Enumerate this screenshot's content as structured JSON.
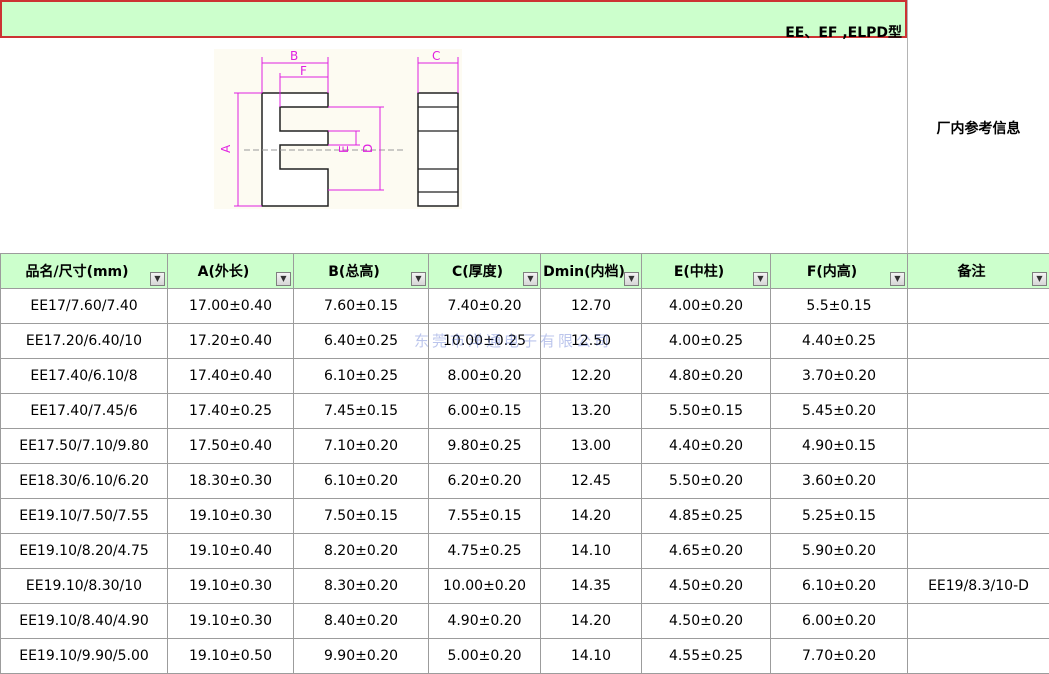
{
  "title": "EE、EF ,ELPD型",
  "side_label": "厂内参考信息",
  "diagram_labels": {
    "a": "A",
    "b": "B",
    "c": "C",
    "d": "D",
    "e": "E",
    "f": "F"
  },
  "columns": [
    "品名/尺寸(mm)",
    "A(外长)",
    "B(总高)",
    "C(厚度)",
    "Dmin(内档)",
    "E(中柱)",
    "F(内高)",
    "备注"
  ],
  "rows": [
    [
      "EE17/7.60/7.40",
      "17.00±0.40",
      "7.60±0.15",
      "7.40±0.20",
      "12.70",
      "4.00±0.20",
      "5.5±0.15",
      ""
    ],
    [
      "EE17.20/6.40/10",
      "17.20±0.40",
      "6.40±0.25",
      "10.00±0.25",
      "12.50",
      "4.00±0.25",
      "4.40±0.25",
      ""
    ],
    [
      "EE17.40/6.10/8",
      "17.40±0.40",
      "6.10±0.25",
      "8.00±0.20",
      "12.20",
      "4.80±0.20",
      "3.70±0.20",
      ""
    ],
    [
      "EE17.40/7.45/6",
      "17.40±0.25",
      "7.45±0.15",
      "6.00±0.15",
      "13.20",
      "5.50±0.15",
      "5.45±0.20",
      ""
    ],
    [
      "EE17.50/7.10/9.80",
      "17.50±0.40",
      "7.10±0.20",
      "9.80±0.25",
      "13.00",
      "4.40±0.20",
      "4.90±0.15",
      ""
    ],
    [
      "EE18.30/6.10/6.20",
      "18.30±0.30",
      "6.10±0.20",
      "6.20±0.20",
      "12.45",
      "5.50±0.20",
      "3.60±0.20",
      ""
    ],
    [
      "EE19.10/7.50/7.55",
      "19.10±0.30",
      "7.50±0.15",
      "7.55±0.15",
      "14.20",
      "4.85±0.25",
      "5.25±0.15",
      ""
    ],
    [
      "EE19.10/8.20/4.75",
      "19.10±0.40",
      "8.20±0.20",
      "4.75±0.25",
      "14.10",
      "4.65±0.20",
      "5.90±0.20",
      ""
    ],
    [
      "EE19.10/8.30/10",
      "19.10±0.30",
      "8.30±0.20",
      "10.00±0.20",
      "14.35",
      "4.50±0.20",
      "6.10±0.20",
      "EE19/8.3/10-D"
    ],
    [
      "EE19.10/8.40/4.90",
      "19.10±0.30",
      "8.40±0.20",
      "4.90±0.20",
      "14.20",
      "4.50±0.20",
      "6.00±0.20",
      ""
    ],
    [
      "EE19.10/9.90/5.00",
      "19.10±0.50",
      "9.90±0.20",
      "5.00±0.20",
      "14.10",
      "4.55±0.25",
      "7.70±0.20",
      ""
    ]
  ],
  "watermark": "东莞市洋通电子有限公司",
  "colors": {
    "header_bg": "#ccffcc",
    "dimension_line": "#e020e0",
    "title_border": "#cc3333"
  },
  "icons": {
    "filter": "dropdown-arrow-icon"
  }
}
